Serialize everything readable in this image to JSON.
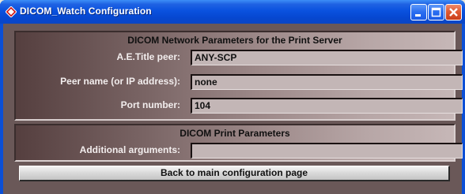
{
  "window": {
    "title": "DICOM_Watch Configuration",
    "icons": [
      "app-icon",
      "minimize-icon",
      "maximize-icon",
      "close-icon"
    ]
  },
  "network_section": {
    "title": "DICOM Network Parameters for the Print Server",
    "ae_title_label": "A.E.Title peer:",
    "ae_title_value": "ANY-SCP",
    "peer_name_label": "Peer name (or IP address):",
    "peer_name_value": "none",
    "port_label": "Port number:",
    "port_value": "104"
  },
  "print_section": {
    "title": "DICOM Print Parameters",
    "additional_args_label": "Additional arguments:",
    "additional_args_value": ""
  },
  "back_button_label": "Back to main configuration page",
  "colors": {
    "titlebar": "#0a52df",
    "panel_dark": "#553f3f",
    "panel_light": "#c6b7b7",
    "field_bg": "#c3b6b6",
    "close_button": "#e05a33"
  }
}
